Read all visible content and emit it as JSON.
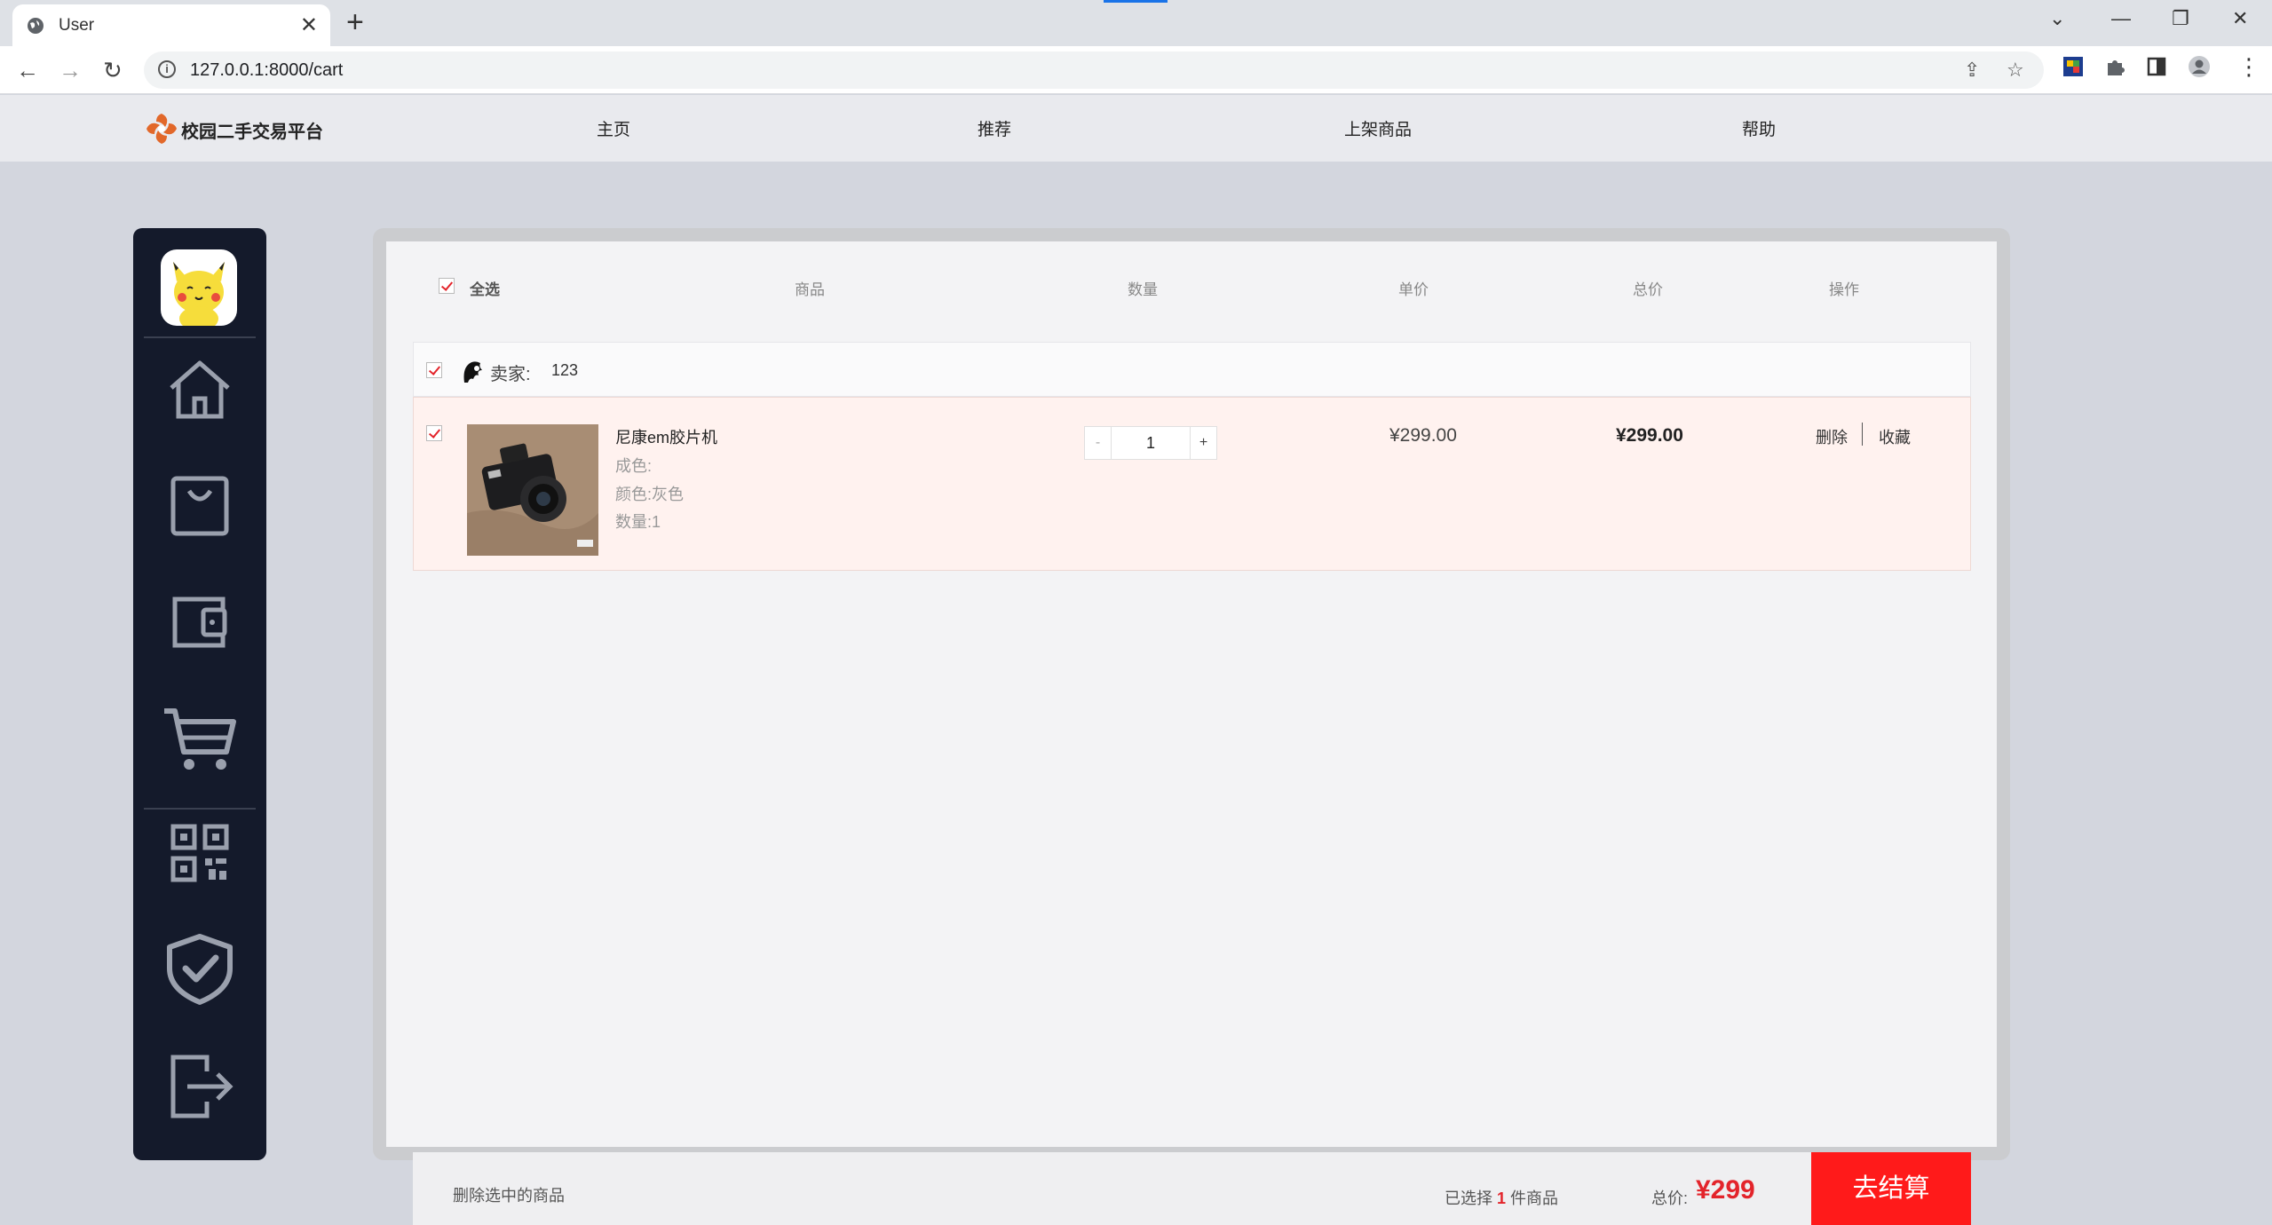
{
  "browser": {
    "tab_title": "User",
    "url": "127.0.0.1:8000/cart"
  },
  "site": {
    "brand": "校园二手交易平台",
    "nav": [
      "主页",
      "推荐",
      "上架商品",
      "帮助"
    ]
  },
  "sidebar": {
    "items": [
      "home-icon",
      "bag-icon",
      "wallet-icon",
      "cart-icon",
      "qrcode-icon",
      "shield-check-icon",
      "logout-icon"
    ]
  },
  "cart": {
    "header": {
      "select_all": "全选",
      "product": "商品",
      "quantity": "数量",
      "unit_price": "单价",
      "total": "总价",
      "action": "操作"
    },
    "seller": {
      "label": "卖家:",
      "name": "123"
    },
    "item": {
      "name": "尼康em胶片机",
      "condition": "成色:",
      "color": "颜色:灰色",
      "count": "数量:1",
      "qty_minus": "-",
      "qty_value": "1",
      "qty_plus": "+",
      "unit_price": "¥299.00",
      "total_price": "¥299.00",
      "delete": "删除",
      "favorite": "收藏"
    },
    "footer": {
      "delete_selected": "删除选中的商品",
      "selected_prefix": "已选择",
      "selected_count": "1",
      "selected_suffix": "件商品",
      "total_label": "总价:",
      "total_value": "¥299",
      "checkout": "去结算"
    }
  },
  "colors": {
    "accent": "#ff1a1a",
    "sidebar_bg": "#141a2b",
    "item_row_bg": "#fff2ef"
  }
}
